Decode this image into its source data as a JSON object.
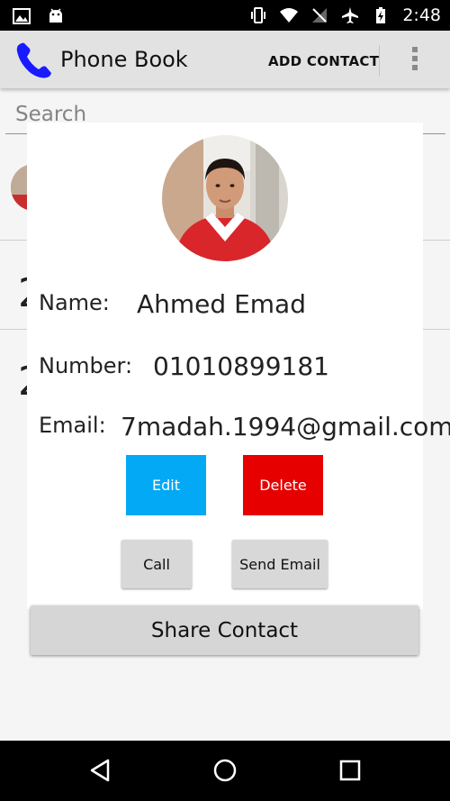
{
  "status_bar": {
    "time": "2:48",
    "icons": [
      "image-icon",
      "android-icon",
      "vibrate-icon",
      "wifi-icon",
      "no-signal-icon",
      "airplane-icon",
      "battery-charging-icon"
    ]
  },
  "app_bar": {
    "title": "Phone Book",
    "logo_icon": "phone-handset-icon",
    "logo_color": "#1a1aff",
    "add_contact_label": "ADD CONTACT",
    "overflow_icon": "more-vert-icon"
  },
  "background_list": {
    "search_placeholder": "Search",
    "partial_digits": [
      "2",
      "2"
    ]
  },
  "dialog": {
    "name_label": "Name:",
    "name_value": "Ahmed Emad",
    "number_label": "Number:",
    "number_value": "01010899181",
    "email_label": "Email:",
    "email_value": "7madah.1994@gmail.com",
    "edit_label": "Edit",
    "delete_label": "Delete",
    "call_label": "Call",
    "send_email_label": "Send Email",
    "edit_color": "#03a9f4",
    "delete_color": "#e60000"
  },
  "share_contact_label": "Share Contact",
  "nav_bar": {
    "icons": [
      "back-icon",
      "home-icon",
      "recents-icon"
    ]
  }
}
